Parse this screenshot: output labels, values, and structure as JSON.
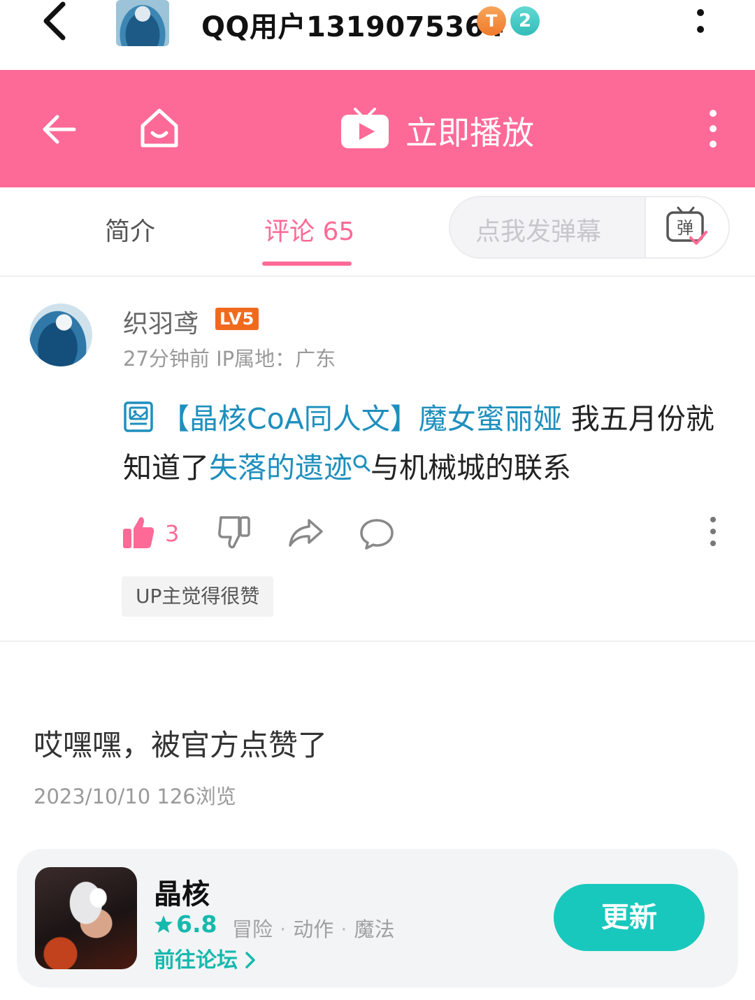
{
  "header": {
    "title": "QQ用户1319075364",
    "badge_t": "T",
    "badge_level": "2"
  },
  "navbar": {
    "play_label": "立即播放"
  },
  "tabs": {
    "intro": "简介",
    "comments": "评论 65",
    "danmaku_placeholder": "点我发弹幕"
  },
  "comment": {
    "username": "织羽鸢",
    "level": "LV5",
    "meta": "27分钟前  IP属地：广东",
    "link_article": "【晶核CoA同人文】魔女蜜丽娅",
    "text_1": " 我五月份就知道了",
    "link_search": "失落的遗迹",
    "text_2": "与机械城的联系",
    "like_count": "3",
    "up_tag": "UP主觉得很赞"
  },
  "post": {
    "text": "哎嘿嘿，被官方点赞了",
    "meta": "2023/10/10  126浏览"
  },
  "game": {
    "name": "晶核",
    "rating": "6.8",
    "tags": [
      "冒险",
      "动作",
      "魔法"
    ],
    "forum_link": "前往论坛",
    "update_button": "更新"
  },
  "colors": {
    "brand_pink": "#fd6a97",
    "link_blue": "#1e8fbd",
    "teal": "#19c8bc",
    "level_orange": "#f06a1e"
  }
}
